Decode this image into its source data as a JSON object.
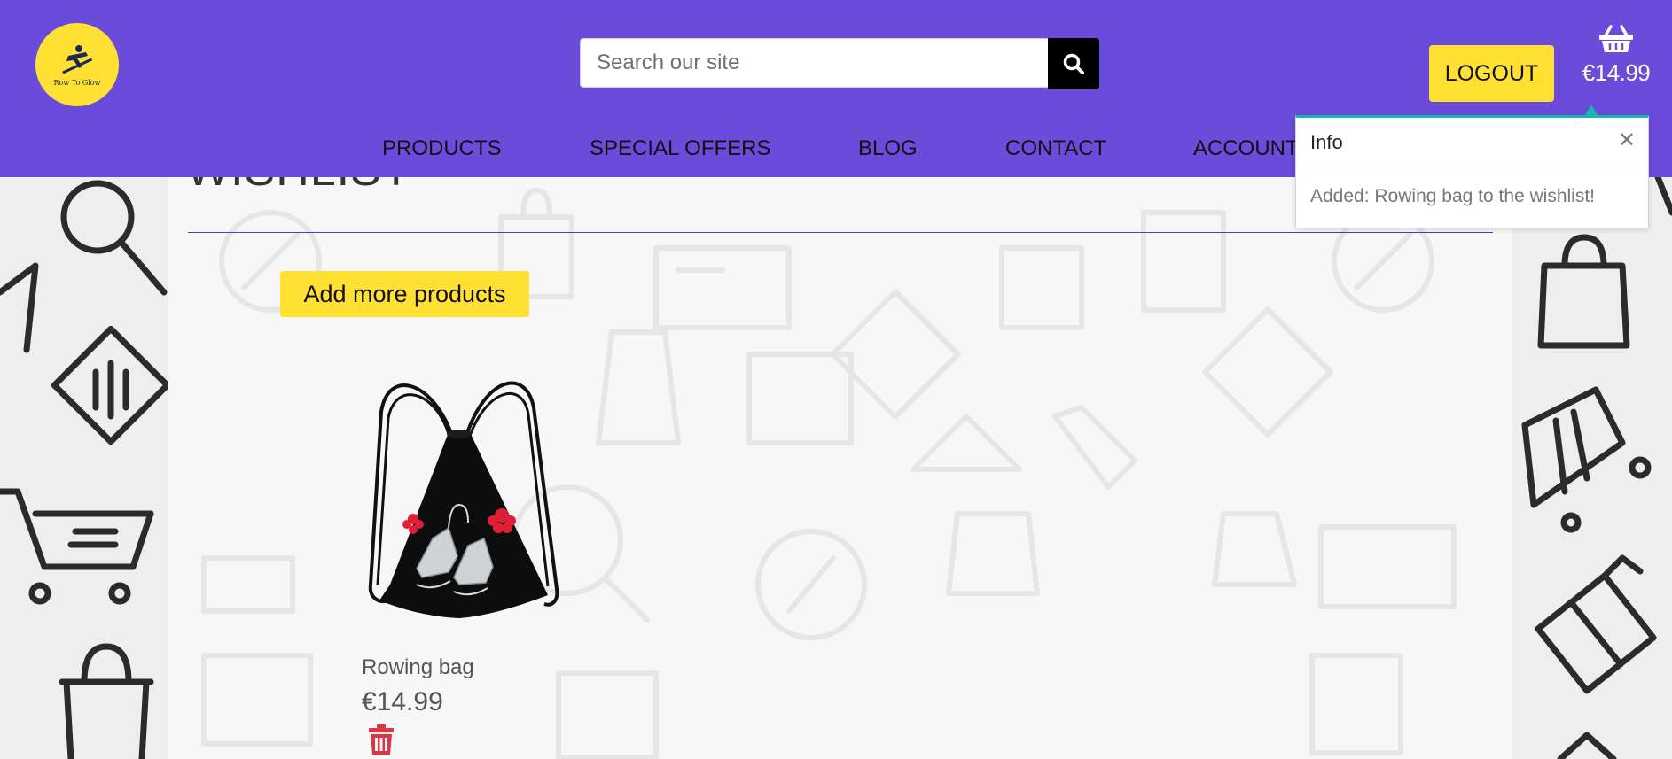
{
  "brand": {
    "logo_text": "Row To Glow",
    "accent": "#6a4bda",
    "highlight": "#ffe033"
  },
  "search": {
    "placeholder": "Search our site",
    "button_icon": "search-icon"
  },
  "account": {
    "logout_label": "LOGOUT"
  },
  "basket": {
    "icon": "basket-icon",
    "total": "€14.99"
  },
  "nav": {
    "items": [
      {
        "label": "PRODUCTS"
      },
      {
        "label": "SPECIAL OFFERS"
      },
      {
        "label": "BLOG"
      },
      {
        "label": "CONTACT"
      },
      {
        "label": "ACCOUNT"
      }
    ]
  },
  "toast": {
    "title": "Info",
    "close_icon": "close-icon",
    "message": "Added: Rowing bag to the wishlist!",
    "accent": "#17b7b0"
  },
  "page": {
    "title": "WISHLIST",
    "add_more_label": "Add more products"
  },
  "wishlist": {
    "items": [
      {
        "name": "Rowing bag",
        "price": "€14.99",
        "delete_icon": "trash-icon",
        "delete_color": "#dc3545"
      }
    ]
  }
}
